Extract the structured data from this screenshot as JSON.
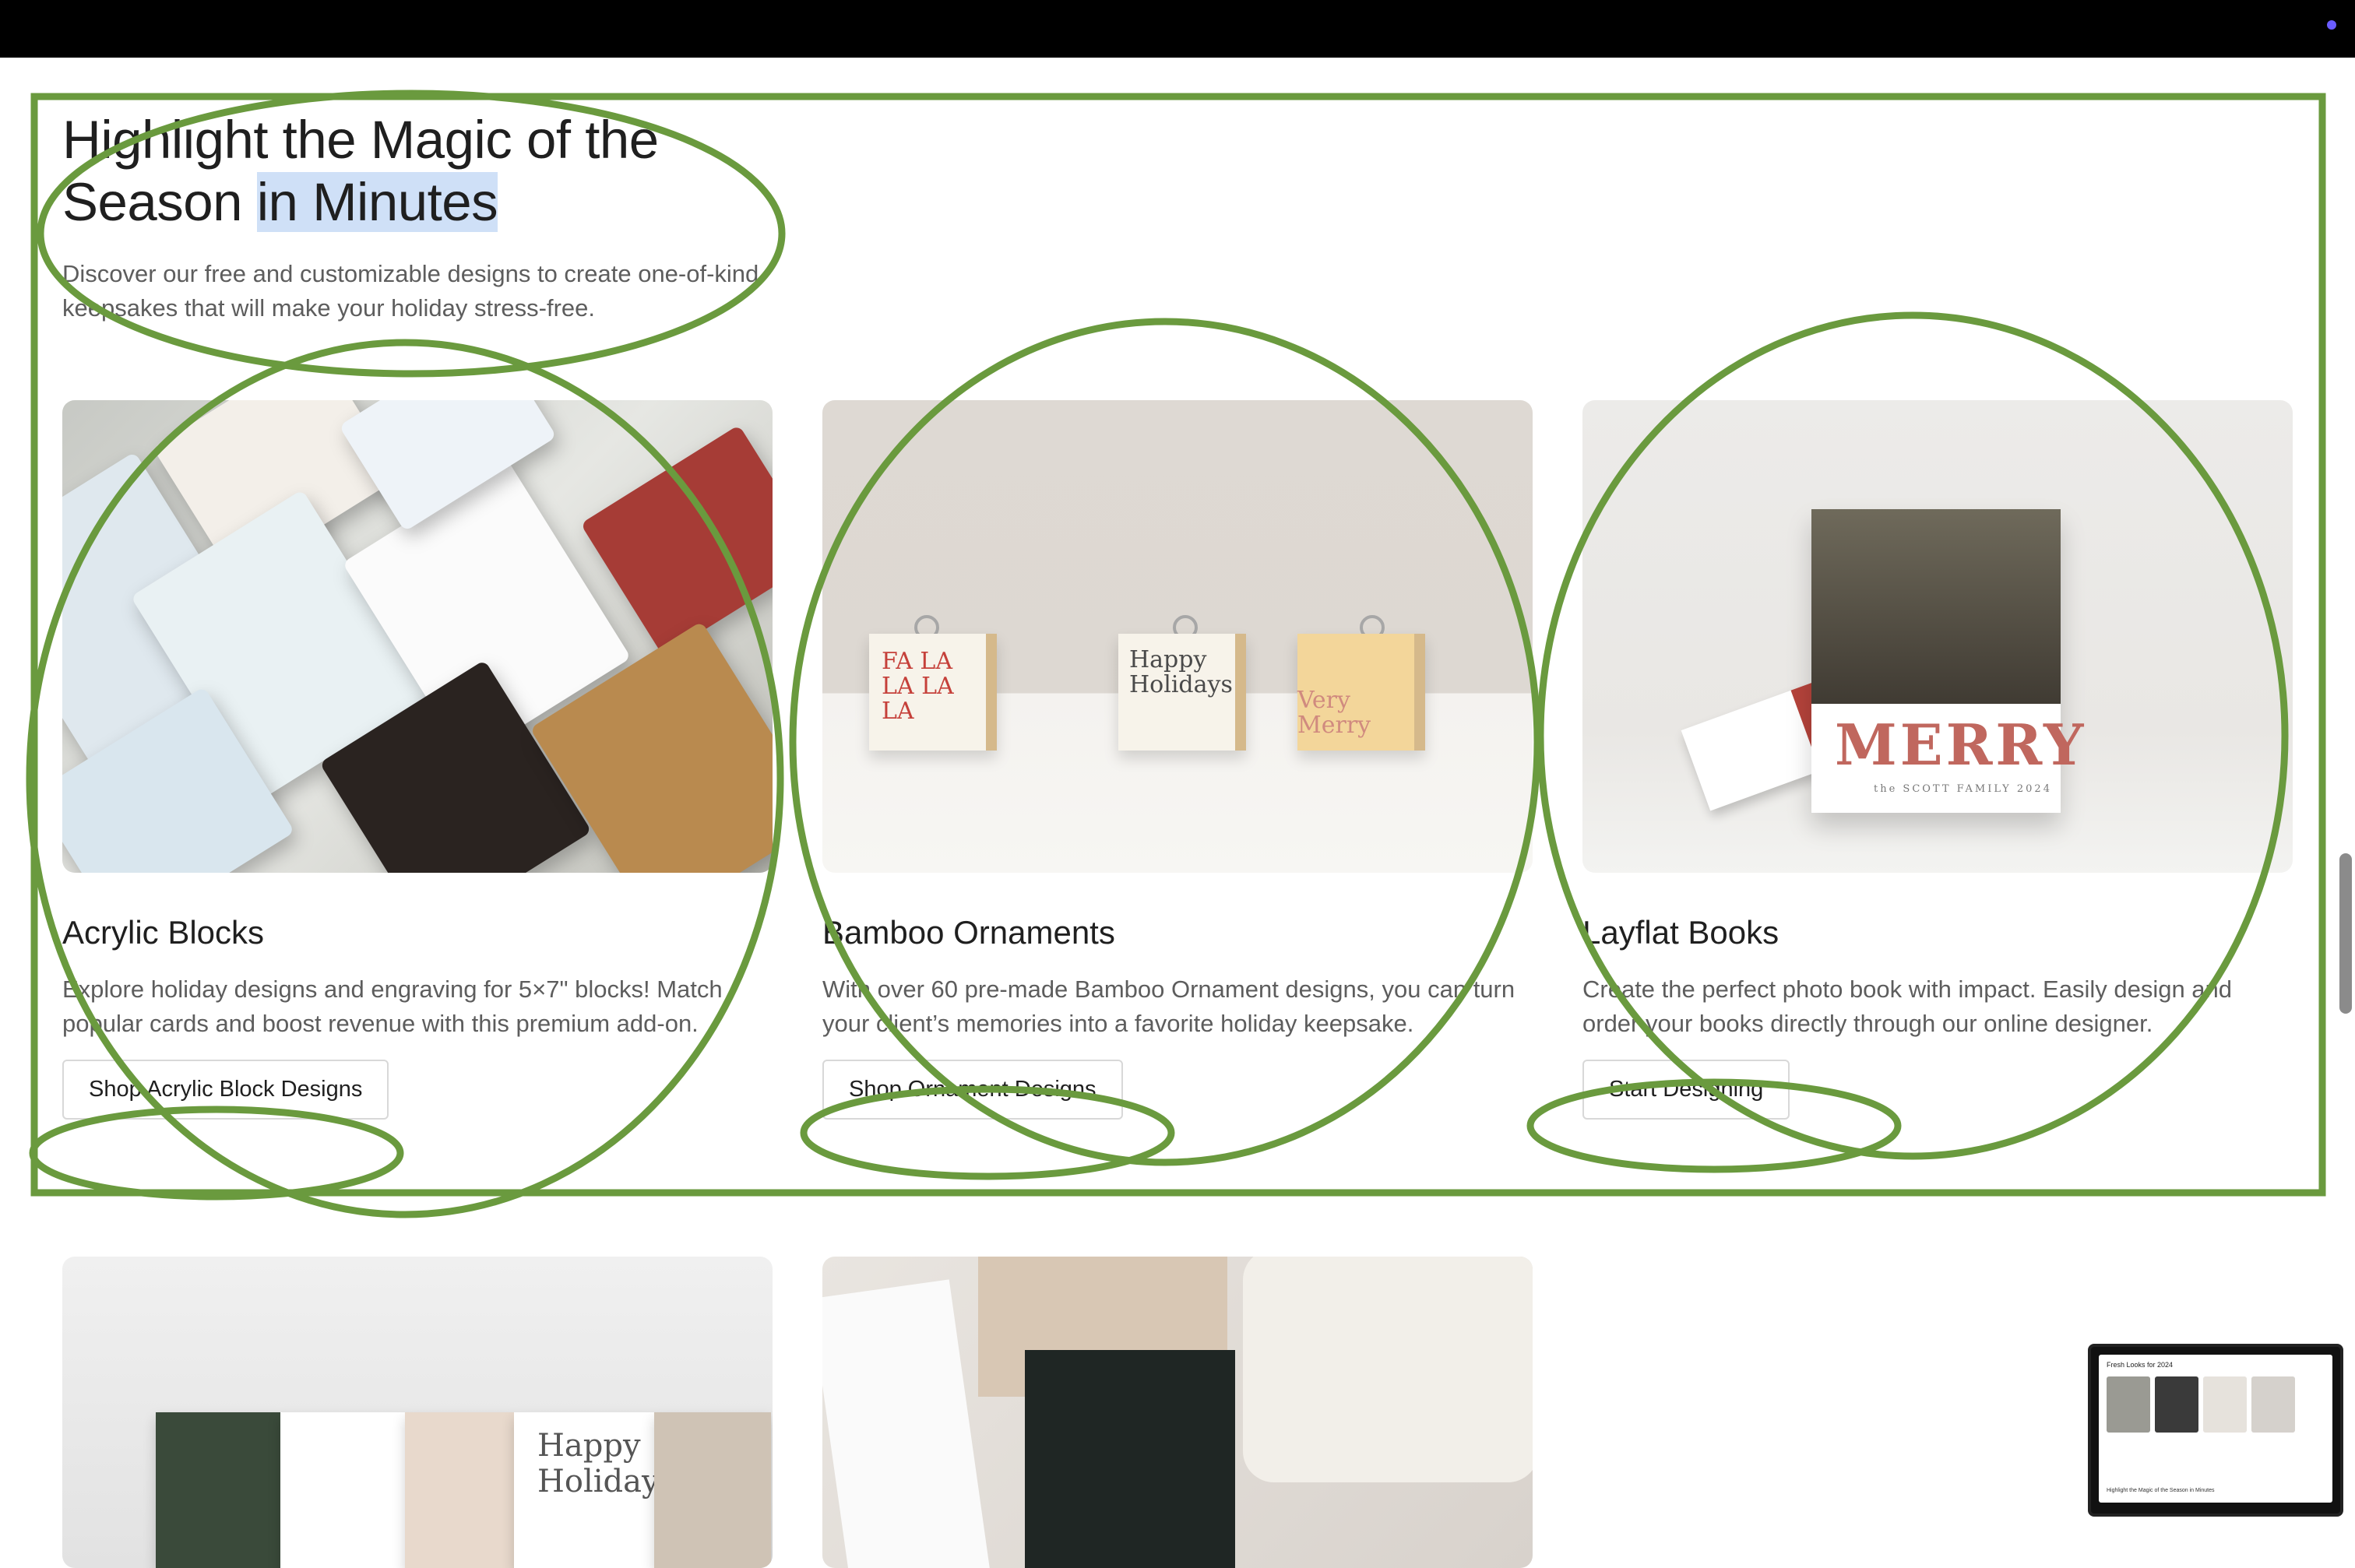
{
  "section": {
    "heading_part1": "Highlight the Magic of the Season ",
    "heading_highlight": "in Minutes",
    "subtitle": "Discover our free and customizable designs to create one-of-kind keepsakes that will make your holiday stress-free."
  },
  "cards": [
    {
      "title": "Acrylic Blocks",
      "description": "Explore holiday designs and engraving for 5×7\" blocks! Match popular cards and boost revenue with this premium add-on.",
      "button": "Shop Acrylic Block Designs"
    },
    {
      "title": "Bamboo Ornaments",
      "description": "With over 60 pre-made Bamboo Ornament designs, you can turn your client’s memories into a favorite holiday keepsake.",
      "button": "Shop Ornament Designs"
    },
    {
      "title": "Layflat Books",
      "description": "Create the perfect photo book with impact. Easily design and order your books directly through our online designer.",
      "button": "Start Designing"
    }
  ],
  "photo_text": {
    "ornament_1": "FA LA LA LA LA",
    "ornament_2": "Happy Holidays",
    "ornament_3": "Very Merry",
    "book_title": "MERRY",
    "book_subtitle": "the SCOTT FAMILY 2024",
    "accordion_text": "Happy Holidays"
  },
  "pip": {
    "title": "Fresh Looks for 2024",
    "caption": "Highlight the Magic of the Season in Minutes"
  },
  "colors": {
    "annotation": "#6a9a3e",
    "highlight": "#cfe0f7"
  }
}
